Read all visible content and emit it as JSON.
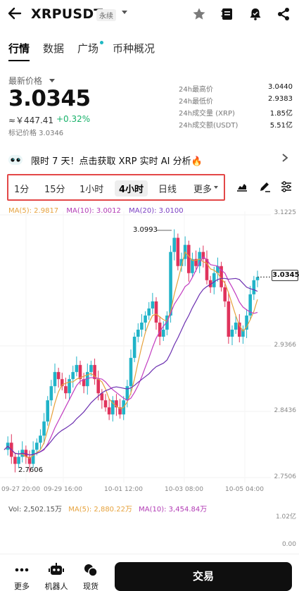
{
  "header": {
    "title": "XRPUSDT",
    "contract_type": "永续",
    "icons": [
      "back-arrow-icon",
      "star-icon",
      "notebook-icon",
      "bell-icon",
      "share-icon"
    ]
  },
  "tabs": [
    {
      "label": "行情",
      "active": true
    },
    {
      "label": "数据",
      "active": false
    },
    {
      "label": "广场",
      "active": false
    },
    {
      "label": "币种概况",
      "active": false
    }
  ],
  "ticker": {
    "label": "最新价格",
    "price": "3.0345",
    "cny": "≈￥447.41",
    "change": "+0.32%",
    "mark_price": "标记价格 3.0346",
    "change_color": "#17b26a"
  },
  "stats": [
    {
      "k": "24h最高价",
      "v": "3.0440"
    },
    {
      "k": "24h最低价",
      "v": "2.9383"
    },
    {
      "k": "24h成交量 (XRP)",
      "v": "1.85亿"
    },
    {
      "k": "24h成交额(USDT)",
      "v": "5.51亿"
    }
  ],
  "banner": {
    "text": "限时 7 天！点击获取 XRP 实时 AI 分析🔥"
  },
  "timeframes": [
    {
      "label": "1分",
      "active": false
    },
    {
      "label": "15分",
      "active": false
    },
    {
      "label": "1小时",
      "active": false
    },
    {
      "label": "4小时",
      "active": true
    },
    {
      "label": "日线",
      "active": false
    },
    {
      "label": "更多",
      "active": false
    }
  ],
  "ma": {
    "ma5": "MA(5): 2.9817",
    "ma10": "MA(10): 3.0012",
    "ma20": "MA(20): 3.0100"
  },
  "chart_data": {
    "type": "candlestick",
    "y_ticks": [
      "3.1225",
      "2.9366",
      "2.8436",
      "2.7506"
    ],
    "x_ticks": [
      "09-27 20:00",
      "09-29 16:00",
      "10-01 12:00",
      "10-03 08:00",
      "10-05 04:00"
    ],
    "high_label": "3.0993",
    "low_label": "2.7606",
    "current_price": "3.0345",
    "ylim": [
      2.7506,
      3.1225
    ],
    "volume": {
      "label": "Vol: 2,502.15万",
      "ma5": "MA(5): 2,880.22万",
      "ma10": "MA(10): 3,454.84万",
      "y_ticks": [
        "1.02亿",
        "0.00"
      ]
    },
    "up_color": "#20b3c8",
    "down_color": "#e0335c"
  },
  "bottom": {
    "items": [
      {
        "label": "更多"
      },
      {
        "label": "机器人"
      },
      {
        "label": "现货"
      }
    ],
    "trade_label": "交易"
  }
}
